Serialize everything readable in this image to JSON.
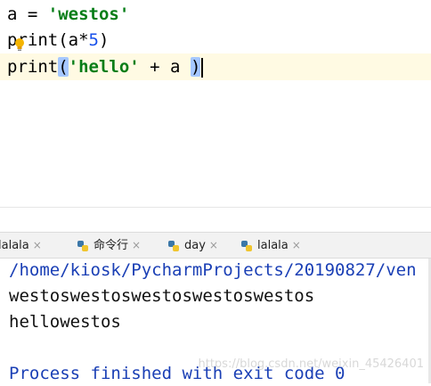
{
  "editor": {
    "line1": {
      "var": "a = ",
      "str": "'westos'"
    },
    "line2": {
      "a": "pr",
      "b": "int(a*",
      "num": "5",
      "c": ")"
    },
    "line3": {
      "fn": "print",
      "open": "(",
      "str": "'hello'",
      "rest": " + a ",
      "close": ")"
    }
  },
  "run_tabs": [
    {
      "label": "lalala",
      "close": "×"
    },
    {
      "label": "命令行",
      "close": "×"
    },
    {
      "label": "day",
      "close": "×"
    },
    {
      "label": "lalala",
      "close": "×"
    }
  ],
  "console": {
    "path": "/home/kiosk/PycharmProjects/20190827/ven",
    "output1": "westoswestoswestoswestoswestos",
    "output2": "hellowestos",
    "exit_message": "Process finished with exit code 0",
    "watermark": "https://blog.csdn.net/weixin_45426401"
  },
  "colors": {
    "string": "#067d17",
    "number": "#1750eb",
    "console_link": "#1a3fb5",
    "current_line": "#fffae3"
  },
  "icons": [
    "lightbulb-icon",
    "python-file-icon",
    "close-icon"
  ]
}
